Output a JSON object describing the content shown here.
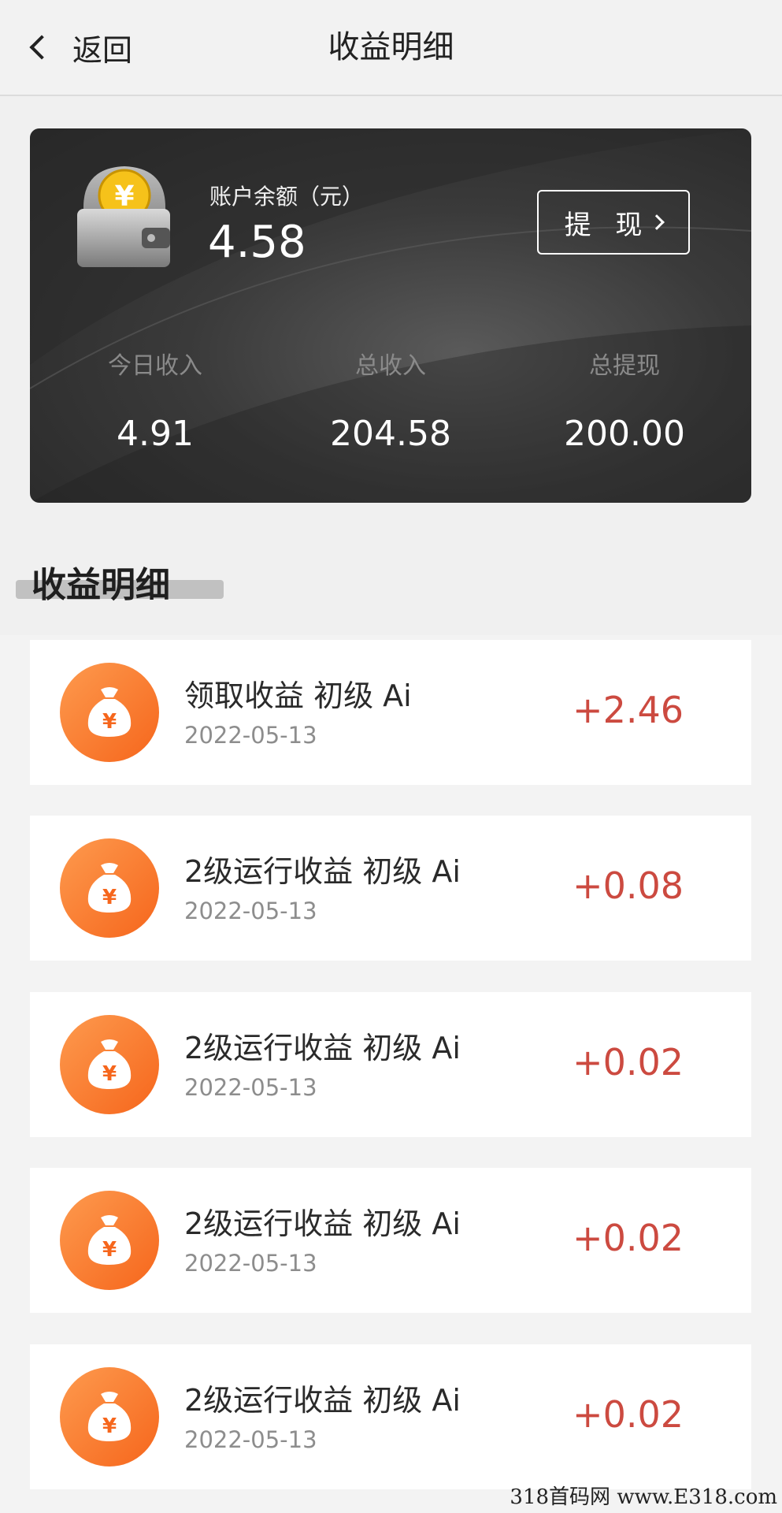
{
  "nav": {
    "back_label": "返回",
    "title": "收益明细"
  },
  "balance": {
    "label": "账户余额（元）",
    "value": "4.58",
    "withdraw_label": "提 现"
  },
  "stats": [
    {
      "label": "今日收入",
      "value": "4.91"
    },
    {
      "label": "总收入",
      "value": "204.58"
    },
    {
      "label": "总提现",
      "value": "200.00"
    }
  ],
  "section": {
    "title": "收益明细"
  },
  "items": [
    {
      "title": "领取收益 初级 Ai",
      "date": "2022-05-13",
      "amount": "+2.46"
    },
    {
      "title": "2级运行收益 初级 Ai",
      "date": "2022-05-13",
      "amount": "+0.08"
    },
    {
      "title": "2级运行收益 初级 Ai",
      "date": "2022-05-13",
      "amount": "+0.02"
    },
    {
      "title": "2级运行收益 初级 Ai",
      "date": "2022-05-13",
      "amount": "+0.02"
    },
    {
      "title": "2级运行收益 初级 Ai",
      "date": "2022-05-13",
      "amount": "+0.02"
    }
  ],
  "icons": {
    "back": "chevron-left-icon",
    "wallet": "wallet-icon",
    "withdraw": "chevron-right-icon",
    "item": "money-bag-icon"
  },
  "colors": {
    "amount": "#cc4a40",
    "icon_orange": "#fb7a2e",
    "card_dark": "#2e2e2e",
    "coin_gold": "#f6c21a"
  },
  "watermark": "318首码网 www.E318.com"
}
